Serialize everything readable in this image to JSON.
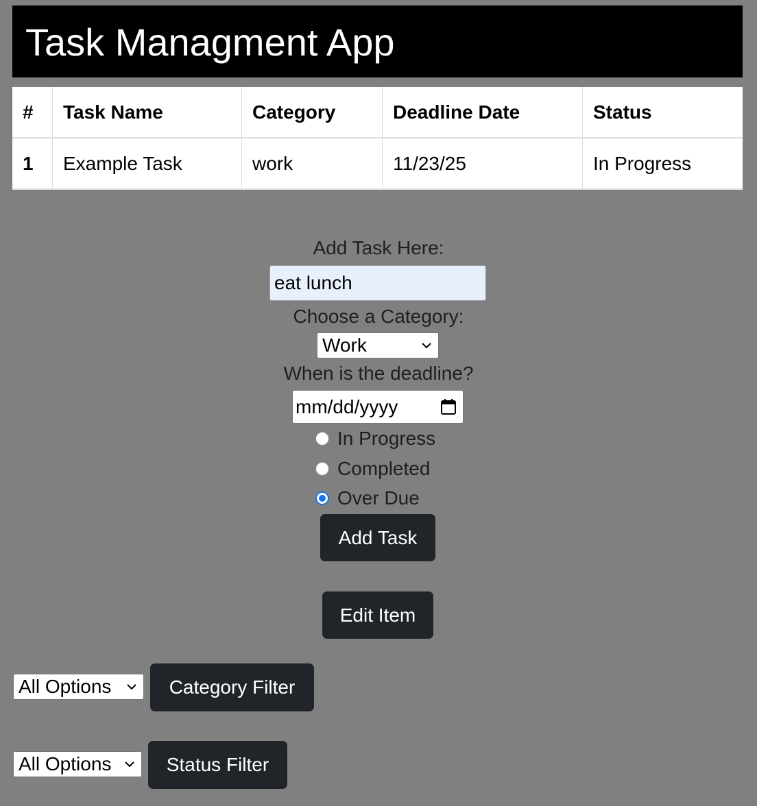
{
  "app": {
    "title": "Task Managment App"
  },
  "table": {
    "headers": [
      "#",
      "Task Name",
      "Category",
      "Deadline Date",
      "Status"
    ],
    "rows": [
      [
        "1",
        "Example Task",
        "work",
        "11/23/25",
        "In Progress"
      ]
    ]
  },
  "form": {
    "task_label": "Add Task Here:",
    "task_value": "eat lunch",
    "category_label": "Choose a Category:",
    "category_selected": "Work",
    "deadline_label": "When is the deadline?",
    "deadline_placeholder": "mm/dd/yyyy",
    "status_options": [
      {
        "label": "In Progress",
        "checked": false
      },
      {
        "label": "Completed",
        "checked": false
      },
      {
        "label": "Over Due",
        "checked": true
      }
    ],
    "add_button": "Add Task",
    "edit_button": "Edit Item"
  },
  "filters": {
    "category_select": "All Options",
    "category_button": "Category Filter",
    "status_select": "All Options",
    "status_button": "Status Filter"
  },
  "colors": {
    "background": "#808080",
    "header_bg": "#000000",
    "button_bg": "#212529",
    "input_autofill_bg": "#e8f0fe",
    "radio_accent": "#1a73e8"
  }
}
